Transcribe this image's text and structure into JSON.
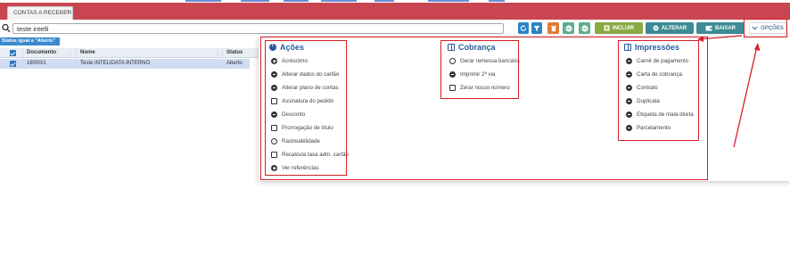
{
  "tab": {
    "label": "CONTAS A RECEBER",
    "close": "×"
  },
  "search": {
    "value": "teste intelli",
    "placeholder": ""
  },
  "toolbar": {
    "incluir": "INCLUIR",
    "alterar": "ALTERAR",
    "baixar": "BAIXAR",
    "opcoes": "OPÇÕES"
  },
  "filter_chip": "Status igual a \"Aberto\"",
  "table": {
    "headers": {
      "documento": "Documento",
      "nome": "Nome",
      "status": "Status"
    },
    "rows": [
      {
        "documento": "18000/1",
        "nome": "Teste INTELIDATA INTERNO",
        "status": "Aberto"
      }
    ]
  },
  "options": {
    "acoes": {
      "title": "Ações",
      "items": [
        "Acréscimo",
        "Alterar dados do cartão",
        "Alterar plano de contas",
        "Assinatura do pedido",
        "Desconto",
        "Prorrogação de título",
        "Rastreabilidade",
        "Recalcula taxa adm. cartão",
        "Ver referências"
      ]
    },
    "cobranca": {
      "title": "Cobrança",
      "items": [
        "Gerar remessa bancária",
        "Imprimir 2ª via",
        "Zerar nosso número"
      ]
    },
    "impressoes": {
      "title": "Impressões",
      "items": [
        "Carnê de pagamento",
        "Carta de cobrança",
        "Contrato",
        "Duplicata",
        "Etiqueta de mala direta",
        "Parcelamento"
      ]
    }
  },
  "colors": {
    "header_red": "#c9454f",
    "annotation_red": "#d61f26",
    "accent_blue": "#2c5a9e"
  }
}
